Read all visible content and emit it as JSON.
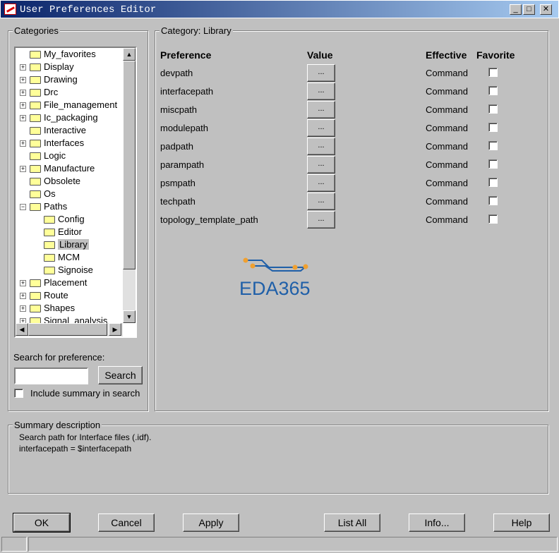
{
  "window": {
    "title": "User Preferences Editor",
    "minimize": "_",
    "maximize": "□",
    "close": "✕"
  },
  "categories": {
    "label": "Categories",
    "items": [
      {
        "label": "My_favorites",
        "level": 0,
        "expandable": false
      },
      {
        "label": "Display",
        "level": 0,
        "expandable": true
      },
      {
        "label": "Drawing",
        "level": 0,
        "expandable": true
      },
      {
        "label": "Drc",
        "level": 0,
        "expandable": true
      },
      {
        "label": "File_management",
        "level": 0,
        "expandable": true
      },
      {
        "label": "Ic_packaging",
        "level": 0,
        "expandable": true
      },
      {
        "label": "Interactive",
        "level": 0,
        "expandable": false
      },
      {
        "label": "Interfaces",
        "level": 0,
        "expandable": true
      },
      {
        "label": "Logic",
        "level": 0,
        "expandable": false
      },
      {
        "label": "Manufacture",
        "level": 0,
        "expandable": true
      },
      {
        "label": "Obsolete",
        "level": 0,
        "expandable": false
      },
      {
        "label": "Os",
        "level": 0,
        "expandable": false
      },
      {
        "label": "Paths",
        "level": 0,
        "expandable": true,
        "expanded": true
      },
      {
        "label": "Config",
        "level": 1,
        "expandable": false
      },
      {
        "label": "Editor",
        "level": 1,
        "expandable": false
      },
      {
        "label": "Library",
        "level": 1,
        "expandable": false,
        "selected": true
      },
      {
        "label": "MCM",
        "level": 1,
        "expandable": false
      },
      {
        "label": "Signoise",
        "level": 1,
        "expandable": false
      },
      {
        "label": "Placement",
        "level": 0,
        "expandable": true
      },
      {
        "label": "Route",
        "level": 0,
        "expandable": true
      },
      {
        "label": "Shapes",
        "level": 0,
        "expandable": true
      },
      {
        "label": "Signal_analysis",
        "level": 0,
        "expandable": true
      }
    ],
    "search_label": "Search for preference:",
    "search_value": "",
    "search_button": "Search",
    "include_summary": "Include summary in search",
    "include_summary_checked": false
  },
  "category": {
    "label": "Category:  Library",
    "headers": {
      "preference": "Preference",
      "value": "Value",
      "effective": "Effective",
      "favorite": "Favorite"
    },
    "rows": [
      {
        "name": "devpath",
        "value": "...",
        "effective": "Command",
        "favorite": false
      },
      {
        "name": "interfacepath",
        "value": "...",
        "effective": "Command",
        "favorite": false
      },
      {
        "name": "miscpath",
        "value": "...",
        "effective": "Command",
        "favorite": false
      },
      {
        "name": "modulepath",
        "value": "...",
        "effective": "Command",
        "favorite": false
      },
      {
        "name": "padpath",
        "value": "...",
        "effective": "Command",
        "favorite": false
      },
      {
        "name": "parampath",
        "value": "...",
        "effective": "Command",
        "favorite": false
      },
      {
        "name": "psmpath",
        "value": "...",
        "effective": "Command",
        "favorite": false
      },
      {
        "name": "techpath",
        "value": "...",
        "effective": "Command",
        "favorite": false
      },
      {
        "name": "topology_template_path",
        "value": "...",
        "effective": "Command",
        "favorite": false
      }
    ]
  },
  "watermark": {
    "text": "EDA365",
    "color": "#1f5fa8",
    "accent": "#f0a030"
  },
  "summary": {
    "label": "Summary description",
    "line1": "Search path for Interface files (.idf).",
    "line2": "interfacepath = $interfacepath"
  },
  "buttons": {
    "ok": "OK",
    "cancel": "Cancel",
    "apply": "Apply",
    "list_all": "List All",
    "info": "Info...",
    "help": "Help"
  }
}
